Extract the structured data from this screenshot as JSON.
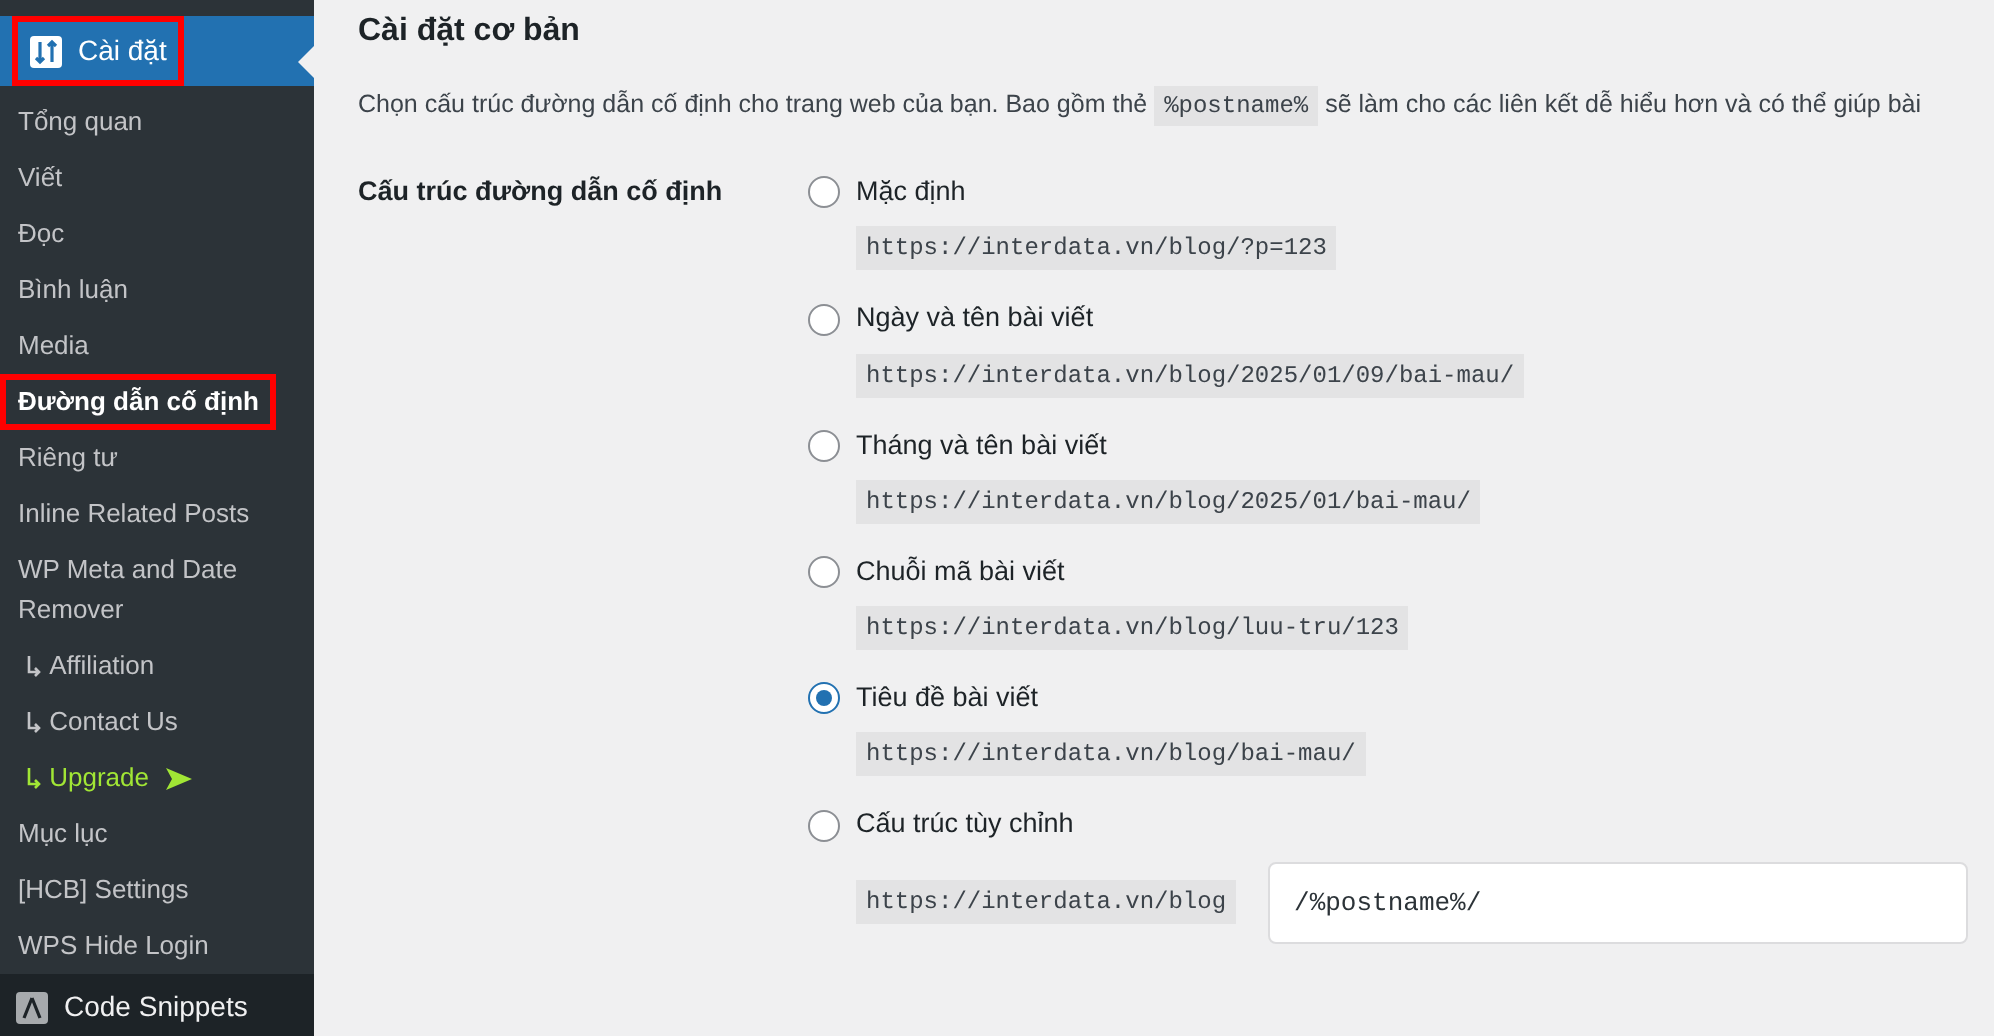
{
  "sidebar": {
    "top_item": {
      "label": "Cài đặt",
      "selected": true,
      "highlighted": true
    },
    "items": [
      {
        "label": "Tổng quan",
        "kind": "plain",
        "selected": false,
        "highlighted": false
      },
      {
        "label": "Viết",
        "kind": "plain",
        "selected": false,
        "highlighted": false
      },
      {
        "label": "Đọc",
        "kind": "plain",
        "selected": false,
        "highlighted": false
      },
      {
        "label": "Bình luận",
        "kind": "plain",
        "selected": false,
        "highlighted": false
      },
      {
        "label": "Media",
        "kind": "plain",
        "selected": false,
        "highlighted": false
      },
      {
        "label": "Đường dẫn cố định",
        "kind": "plain",
        "selected": true,
        "highlighted": true
      },
      {
        "label": "Riêng tư",
        "kind": "plain",
        "selected": false,
        "highlighted": false
      },
      {
        "label": "Inline Related Posts",
        "kind": "plain",
        "selected": false,
        "highlighted": false
      },
      {
        "label": "WP Meta and Date Remover",
        "kind": "plain",
        "selected": false,
        "highlighted": false
      },
      {
        "label": "Affiliation",
        "kind": "sub",
        "selected": false,
        "highlighted": false
      },
      {
        "label": "Contact Us",
        "kind": "sub",
        "selected": false,
        "highlighted": false
      },
      {
        "label": "Upgrade",
        "kind": "upgrade",
        "selected": false,
        "highlighted": false
      },
      {
        "label": "Mục lục",
        "kind": "plain",
        "selected": false,
        "highlighted": false
      },
      {
        "label": "[HCB] Settings",
        "kind": "plain",
        "selected": false,
        "highlighted": false
      },
      {
        "label": "WPS Hide Login",
        "kind": "plain",
        "selected": false,
        "highlighted": false
      }
    ],
    "next_menu": {
      "label": "Code Snippets"
    }
  },
  "main": {
    "heading": "Cài đặt cơ bản",
    "description": {
      "before": "Chọn cấu trúc đường dẫn cố định cho trang web của bạn. Bao gồm thẻ",
      "tag": "%postname%",
      "after": "sẽ làm cho các liên kết dễ hiểu hơn và có thể giúp bài"
    },
    "field_label": "Cấu trúc đường dẫn cố định",
    "options": [
      {
        "label": "Mặc định",
        "example": "https://interdata.vn/blog/?p=123",
        "kind": "preset",
        "selected": false
      },
      {
        "label": "Ngày và tên bài viết",
        "example": "https://interdata.vn/blog/2025/01/09/bai-mau/",
        "kind": "preset",
        "selected": false
      },
      {
        "label": "Tháng và tên bài viết",
        "example": "https://interdata.vn/blog/2025/01/bai-mau/",
        "kind": "preset",
        "selected": false
      },
      {
        "label": "Chuỗi mã bài viết",
        "example": "https://interdata.vn/blog/luu-tru/123",
        "kind": "preset",
        "selected": false
      },
      {
        "label": "Tiêu đề bài viết",
        "example": "https://interdata.vn/blog/bai-mau/",
        "kind": "preset",
        "selected": true
      },
      {
        "label": "Cấu trúc tùy chỉnh",
        "example": "https://interdata.vn/blog",
        "value": "/%postname%/",
        "kind": "custom",
        "selected": false
      }
    ]
  }
}
